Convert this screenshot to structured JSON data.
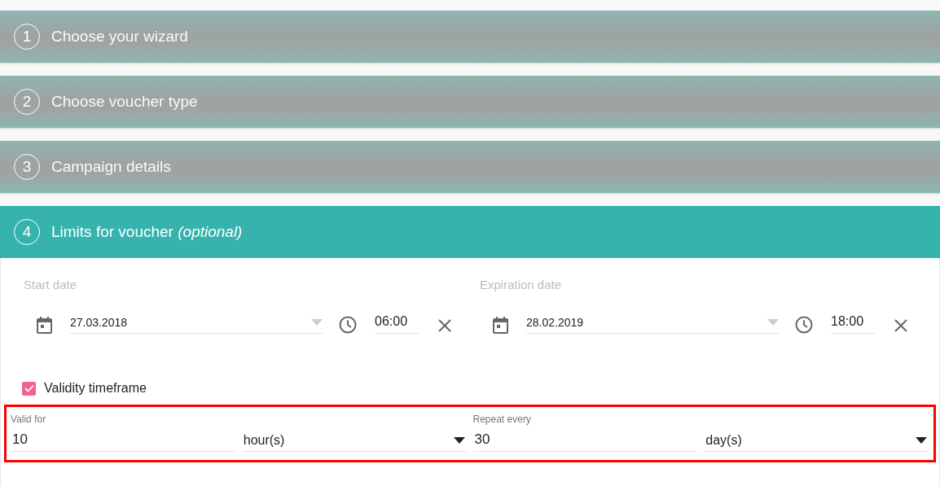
{
  "steps": [
    {
      "number": "1",
      "title": "Choose your wizard",
      "selected": false
    },
    {
      "number": "2",
      "title": "Choose voucher type",
      "selected": false
    },
    {
      "number": "3",
      "title": "Campaign details",
      "selected": false
    },
    {
      "number": "4",
      "title": "Limits for voucher *(optional)*",
      "selected": true
    }
  ],
  "dates": [
    {
      "label": "Start date",
      "date": "27.03.2018",
      "time": "06:00"
    },
    {
      "label": "Expiration date",
      "date": "28.02.2019",
      "time": "18:00"
    }
  ],
  "validity": {
    "label": "Validity timeframe",
    "checked": true
  },
  "timeframe": [
    {
      "label": "Valid for",
      "value": "10",
      "unit": "hour(s)"
    },
    {
      "label": "Repeat every",
      "value": "30",
      "unit": "day(s)"
    }
  ]
}
